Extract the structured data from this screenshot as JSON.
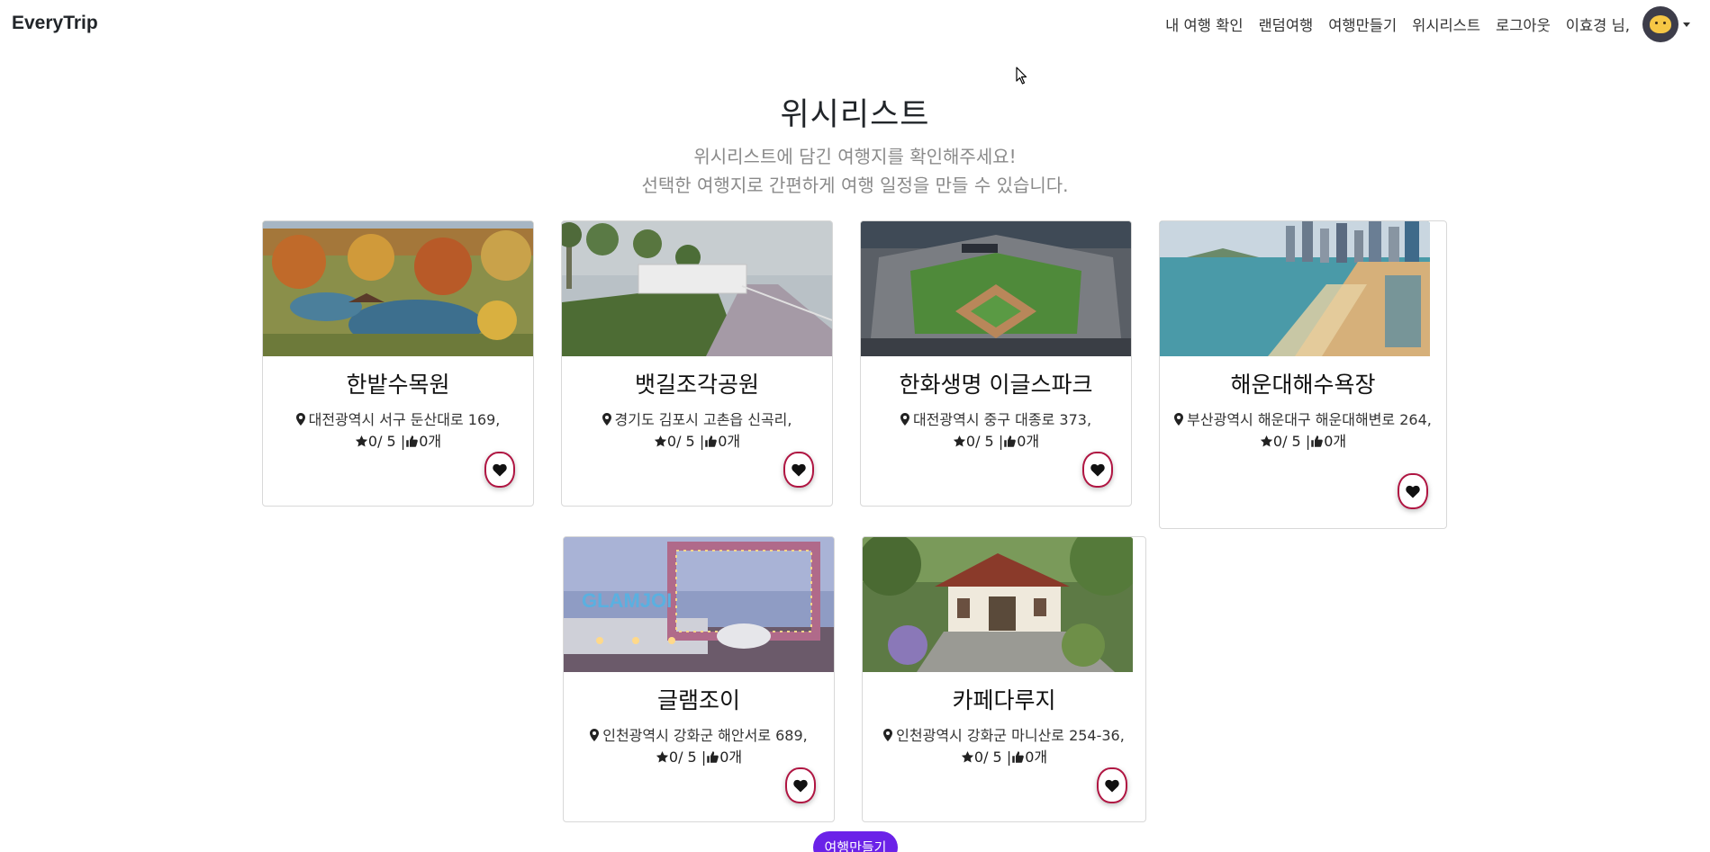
{
  "navbar": {
    "brand": "EveryTrip",
    "links": [
      "내 여행 확인",
      "랜덤여행",
      "여행만들기",
      "위시리스트",
      "로그아웃"
    ],
    "user_greeting": "이효경 님,"
  },
  "hero": {
    "title": "위시리스트",
    "subtitle_line1": "위시리스트에 담긴 여행지를 확인해주세요!",
    "subtitle_line2": "선택한 여행지로 간편하게 여행 일정을 만들 수 있습니다."
  },
  "cards": [
    {
      "title": "한밭수목원",
      "address": "대전광역시 서구 둔산대로 169,",
      "rating": "0/ 5 |",
      "likes": "0개"
    },
    {
      "title": "뱃길조각공원",
      "address": "경기도 김포시 고촌읍 신곡리,",
      "rating": "0/ 5 |",
      "likes": "0개"
    },
    {
      "title": "한화생명 이글스파크",
      "address": "대전광역시 중구 대종로 373,",
      "rating": "0/ 5 |",
      "likes": "0개"
    },
    {
      "title": "해운대해수욕장",
      "address": "부산광역시 해운대구 해운대해변로 264,",
      "rating": "0/ 5 |",
      "likes": "0개"
    },
    {
      "title": "글램조이",
      "address": "인천광역시 강화군 해안서로 689,",
      "rating": "0/ 5 |",
      "likes": "0개",
      "image_text": "GLAMJOI"
    },
    {
      "title": "카페다루지",
      "address": "인천광역시 강화군 마니산로 254-36,",
      "rating": "0/ 5 |",
      "likes": "0개"
    }
  ],
  "make_trip_button": "여행만들기",
  "colors": {
    "heart_border": "#b01542",
    "button_purple": "#6b22e8",
    "subtitle_gray": "#8a8a8a"
  }
}
